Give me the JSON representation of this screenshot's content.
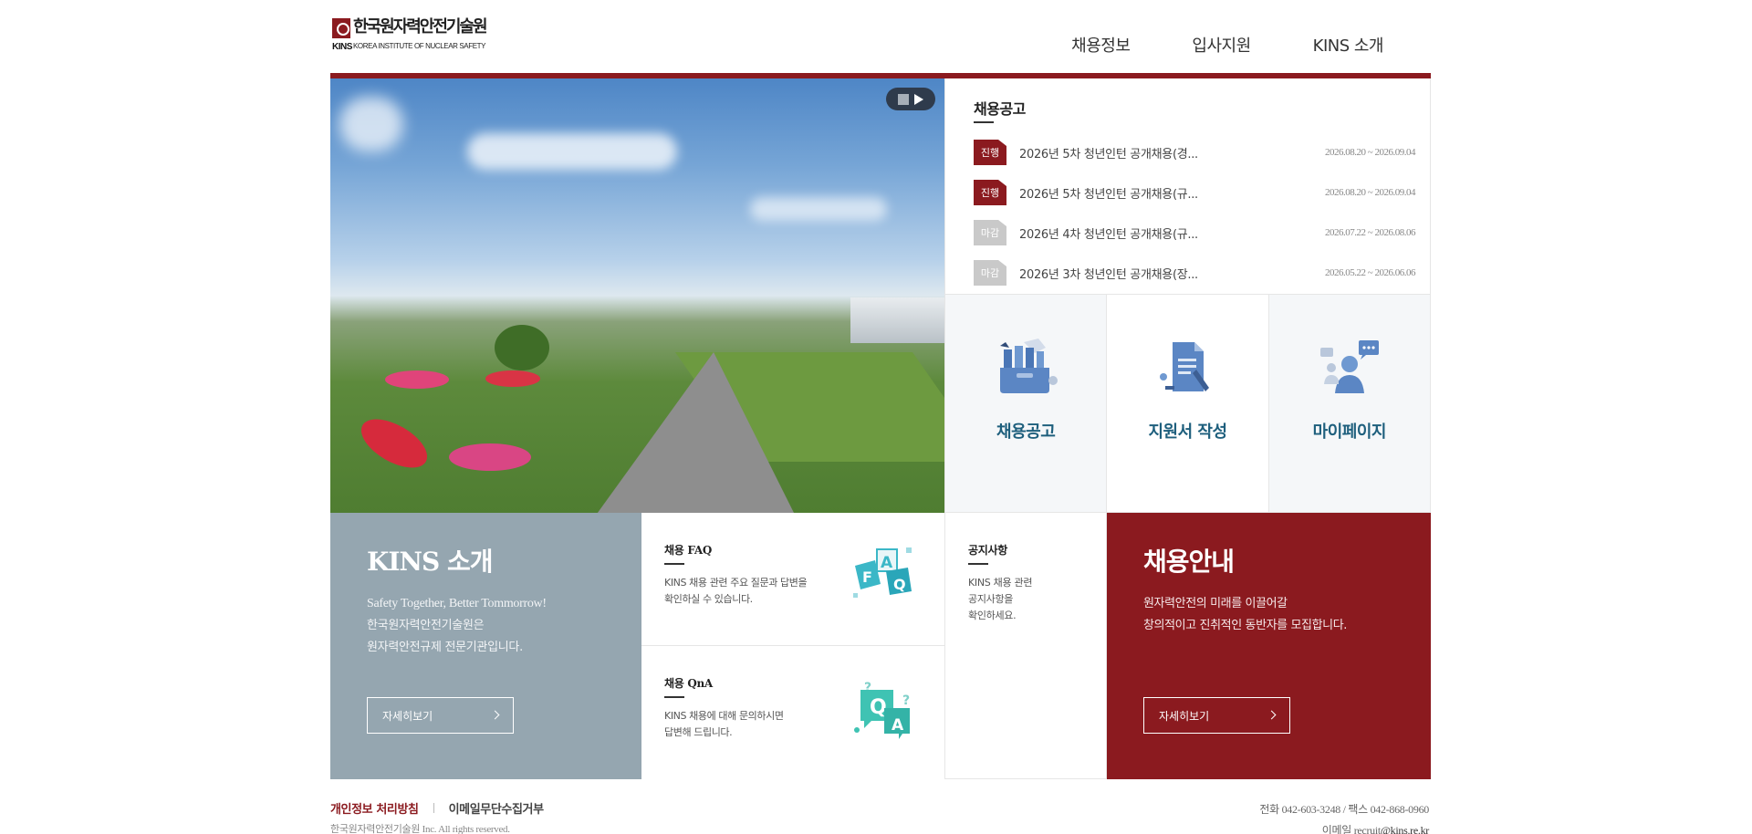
{
  "header": {
    "logo_ko": "한국원자력안전기술원",
    "logo_kins": "KINS",
    "logo_en": "KOREA INSTITUTE OF NUCLEAR SAFETY",
    "nav": [
      "채용정보",
      "입사지원",
      "KINS 소개"
    ]
  },
  "notice": {
    "title": "채용공고",
    "items": [
      {
        "status": "진행",
        "title": "2026년 5차 청년인턴 공개채용(경...",
        "period": "2026.08.20 ~ 2026.09.04"
      },
      {
        "status": "진행",
        "title": "2026년 5차 청년인턴 공개채용(규...",
        "period": "2026.08.20 ~ 2026.09.04"
      },
      {
        "status": "마감",
        "title": "2026년 4차 청년인턴 공개채용(규...",
        "period": "2026.07.22 ~ 2026.08.06"
      },
      {
        "status": "마감",
        "title": "2026년 3차 청년인턴 공개채용(장...",
        "period": "2026.05.22 ~ 2026.06.06"
      }
    ]
  },
  "tiles": [
    {
      "label": "채용공고",
      "icon": "job-posting-icon"
    },
    {
      "label": "지원서 작성",
      "icon": "write-application-icon"
    },
    {
      "label": "마이페이지",
      "icon": "my-page-icon"
    }
  ],
  "intro": {
    "title": "KINS 소개",
    "line1": "Safety Together, Better Tommorrow!",
    "line2": "한국원자력안전기술원은",
    "line3": "원자력안전규제 전문기관입니다.",
    "more": "자세히보기"
  },
  "faq": {
    "title": "채용 FAQ",
    "line1": "KINS 채용 관련 주요 질문과 답변을",
    "line2": "확인하실 수 있습니다."
  },
  "qna": {
    "title": "채용 QnA",
    "line1": "KINS 채용에 대해 문의하시면",
    "line2": "답변해 드립니다."
  },
  "notices": {
    "title": "공지사항",
    "line1": "KINS 채용 관련",
    "line2": "공지사항을",
    "line3": "확인하세요."
  },
  "guide": {
    "title": "채용안내",
    "line1": "원자력안전의 미래를 이끌어갈",
    "line2": "창의적이고 진취적인 동반자를 모집합니다.",
    "more": "자세히보기"
  },
  "footer": {
    "privacy": "개인정보 처리방침",
    "email_refuse": "이메일무단수집거부",
    "copyright": "한국원자력안전기술원 Inc. All rights reserved.",
    "phone": "전화 042-603-3248 / 팩스 042-868-0960",
    "email_label": "이메일 recruit",
    "email_domain": "@kins.re.kr"
  },
  "colors": {
    "brand": "#8b1a1f",
    "intro_bg": "#95a6b0",
    "tile_label": "#1e5f7d",
    "badge_closed": "#c9c9c9"
  }
}
